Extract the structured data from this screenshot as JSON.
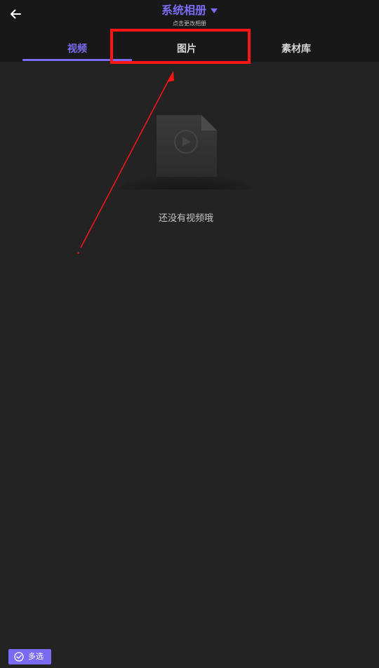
{
  "header": {
    "back_icon": "arrow-left-icon",
    "album_title": "系统相册",
    "album_caret_icon": "caret-down-icon",
    "album_subtitle": "点击更改相册"
  },
  "tabs": [
    {
      "label": "视频",
      "active": true
    },
    {
      "label": "图片",
      "active": false
    },
    {
      "label": "素材库",
      "active": false
    }
  ],
  "empty_state": {
    "icon": "video-file-icon",
    "message": "还没有视频哦"
  },
  "bottom": {
    "multi_select_label": "多选",
    "multi_select_icon": "check-circle-icon"
  },
  "annotation": {
    "highlight_target": "tab-images",
    "color": "#ff1414"
  },
  "colors": {
    "accent": "#7b6bf2",
    "background": "#232323",
    "header_background": "#181818"
  }
}
